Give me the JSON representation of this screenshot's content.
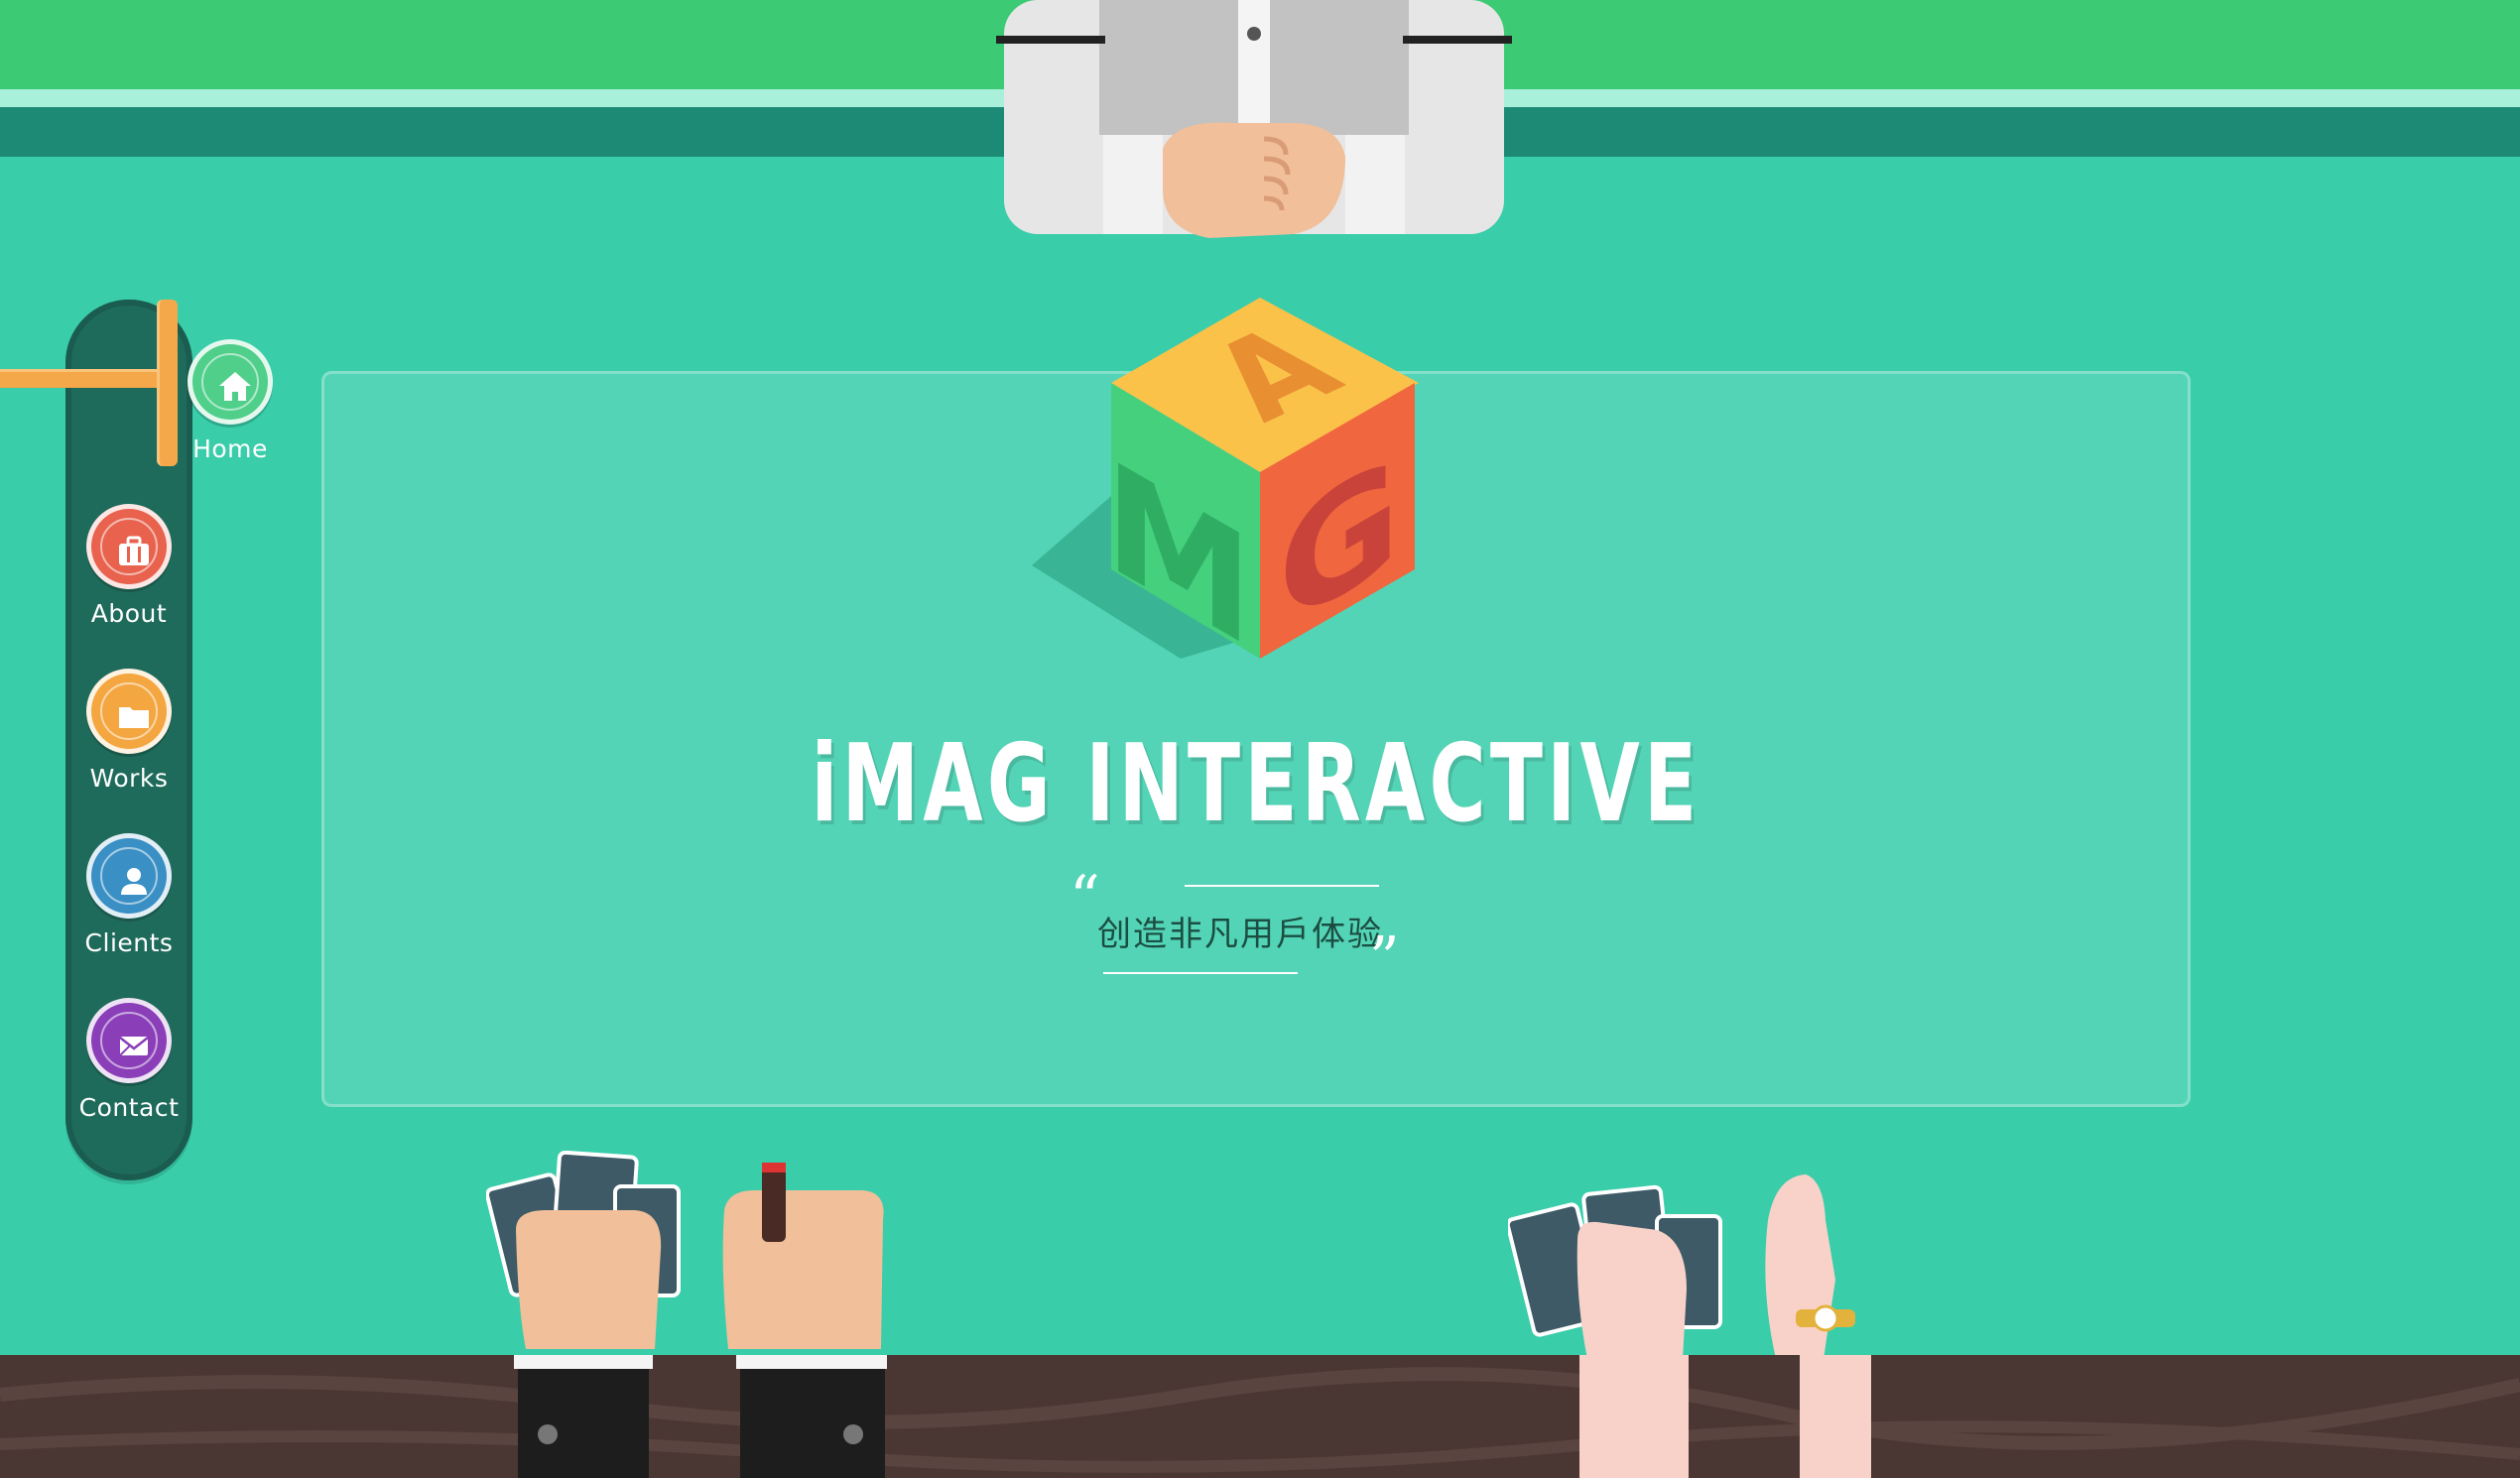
{
  "brand": {
    "title": "iMAG INTERACTIVE",
    "tagline": "创造非凡用戶体验",
    "cube_letters": [
      "A",
      "M",
      "G"
    ]
  },
  "nav": {
    "items": [
      {
        "id": "home",
        "label": "Home",
        "icon": "home-icon",
        "color": "#4fcf8a",
        "active": true
      },
      {
        "id": "about",
        "label": "About",
        "icon": "briefcase-icon",
        "color": "#e8624e",
        "active": false
      },
      {
        "id": "works",
        "label": "Works",
        "icon": "folder-icon",
        "color": "#f4a640",
        "active": false
      },
      {
        "id": "clients",
        "label": "Clients",
        "icon": "user-icon",
        "color": "#3a8fc4",
        "active": false
      },
      {
        "id": "contact",
        "label": "Contact",
        "icon": "envelope-icon",
        "color": "#8a3fb8",
        "active": false
      }
    ]
  },
  "colors": {
    "table": "#39cdaa",
    "wall": "#3cca74",
    "sidebar": "#1f6b5b",
    "floor": "#4a3632",
    "accent": "#f4a84a"
  }
}
